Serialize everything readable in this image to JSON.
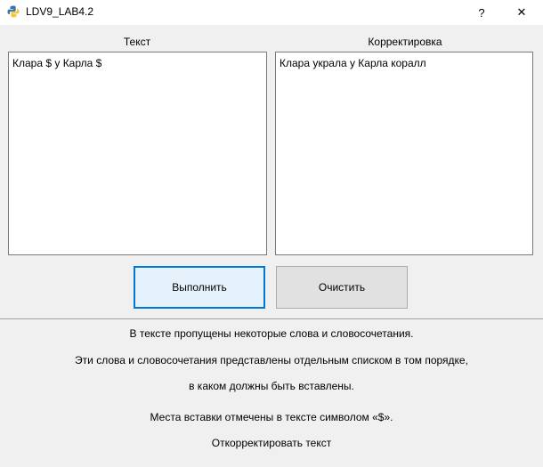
{
  "window": {
    "title": "LDV9_LAB4.2",
    "icon": "python-icon",
    "help_label": "?",
    "close_label": "✕"
  },
  "left_panel": {
    "label": "Текст",
    "content": "Клара $ у Карла $"
  },
  "right_panel": {
    "label": "Корректировка",
    "content": "Клара украла у Карла коралл"
  },
  "buttons": {
    "run_label": "Выполнить",
    "clear_label": "Очистить"
  },
  "instructions": [
    "В тексте пропущены некоторые слова и словосочетания.",
    "Эти слова и словосочетания представлены отдельным списком в том порядке,",
    "в каком должны быть вставлены.",
    "Места вставки отмечены в тексте символом «$».",
    "Откорректировать текст"
  ],
  "colors": {
    "focus_border": "#0078d7",
    "window_bg": "#f0f0f0"
  }
}
